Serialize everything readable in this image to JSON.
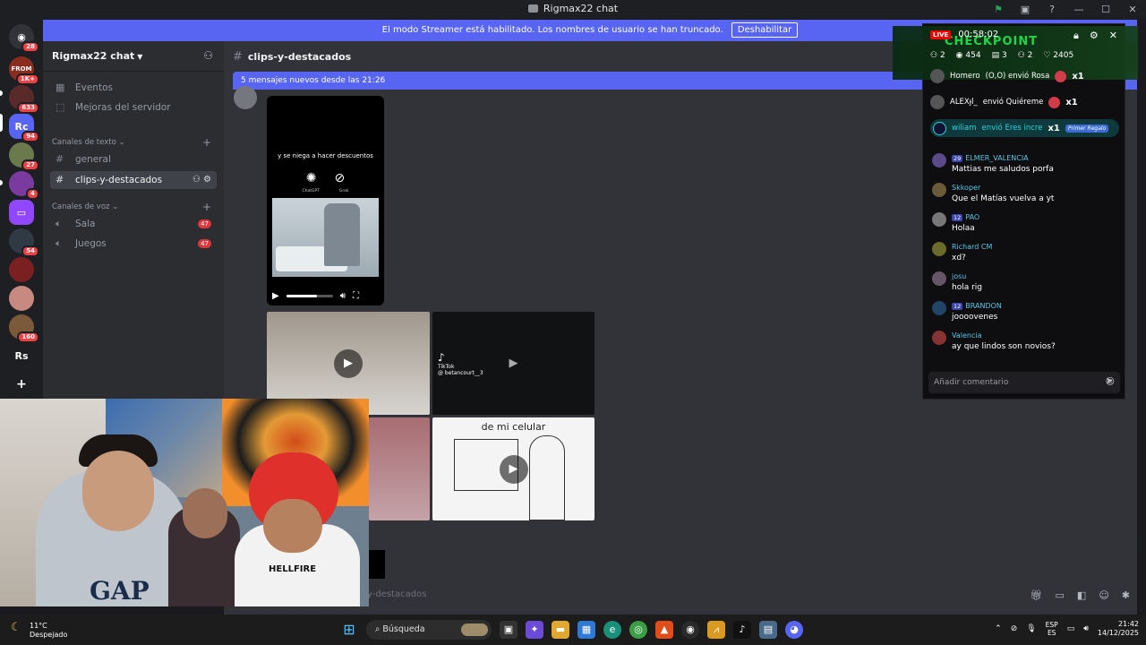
{
  "window": {
    "title": "Rigmax22 chat",
    "controls": [
      "—",
      "☐",
      "✕"
    ]
  },
  "banner": {
    "text": "El modo Streamer está habilitado. Los nombres de usuario se han truncado.",
    "button": "Deshabilitar"
  },
  "guilds": [
    {
      "label": "",
      "badge": "28"
    },
    {
      "label": "FROM",
      "badge": "1K+"
    },
    {
      "label": "",
      "badge": "633"
    },
    {
      "label": "Rc",
      "badge": "94"
    },
    {
      "label": "",
      "badge": "27"
    },
    {
      "label": "",
      "badge": "4"
    },
    {
      "label": "",
      "badge": ""
    },
    {
      "label": "",
      "badge": "54"
    },
    {
      "label": "",
      "badge": ""
    },
    {
      "label": "",
      "badge": ""
    },
    {
      "label": "",
      "badge": "160"
    },
    {
      "label": "Rs",
      "badge": ""
    },
    {
      "label": "+",
      "badge": ""
    }
  ],
  "sidebar": {
    "server_name": "Rigmax22 chat",
    "events": "Eventos",
    "boosts": "Mejoras del servidor",
    "text_category": "Canales de texto",
    "text_channels": [
      "general",
      "clips-y-destacados"
    ],
    "voice_category": "Canales de voz",
    "voice_channels": [
      {
        "name": "Sala",
        "badge": "47"
      },
      {
        "name": "Juegos",
        "badge": "47"
      }
    ]
  },
  "channel": {
    "name": "clips-y-destacados",
    "new_messages": "5 mensajes nuevos desde las 21:26",
    "input_placeholder": "y-destacados"
  },
  "video1": {
    "caption": "y se niega a hacer descuentos",
    "logo1": "ChatGPT",
    "logo2": "Grok"
  },
  "tiles": {
    "tiktok_label": "TikTok",
    "tiktok_user": "@ betancourt__3",
    "tile_d_text": "de mi celular"
  },
  "webcam": {
    "shirt1": "GAP",
    "shirt3": "HELLFIRE"
  },
  "overlay": {
    "live": "LIVE",
    "timer": "00:58:02",
    "checkpoint": "CHECKPOINT",
    "stats": [
      "2",
      "454",
      "3",
      "2",
      "2405"
    ],
    "gifts": [
      {
        "user": "Homero",
        "text": "(O,O) envió Rosa",
        "count": "x1"
      },
      {
        "user": "ALEXɟl_",
        "text": "envió Quiéreme",
        "count": "x1"
      }
    ],
    "primer": {
      "user": "wiliam",
      "text": "envió Eres incre",
      "count": "x1",
      "tag": "Primer Regalo"
    },
    "chat": [
      {
        "lvl": "29",
        "user": "ELMER_VALENCIA",
        "text": "Mattias me saludos porfa"
      },
      {
        "lvl": "",
        "user": "Skkoper",
        "text": "Que el Matías vuelva a yt"
      },
      {
        "lvl": "12",
        "user": "PAO",
        "text": "Holaa"
      },
      {
        "lvl": "",
        "user": "Richard CM",
        "text": "xd?"
      },
      {
        "lvl": "",
        "user": "josu",
        "text": "hola rig"
      },
      {
        "lvl": "12",
        "user": "BRANDON",
        "text": "joooovenes"
      },
      {
        "lvl": "",
        "user": "Valencia",
        "text": "ay que lindos son novios?"
      }
    ],
    "comment_placeholder": "Añadir comentario"
  },
  "taskbar": {
    "temp": "11°C",
    "condition": "Despejado",
    "search": "Búsqueda",
    "lang1": "ESP",
    "lang2": "ES",
    "time": "21:42",
    "date": "14/12/2025"
  }
}
